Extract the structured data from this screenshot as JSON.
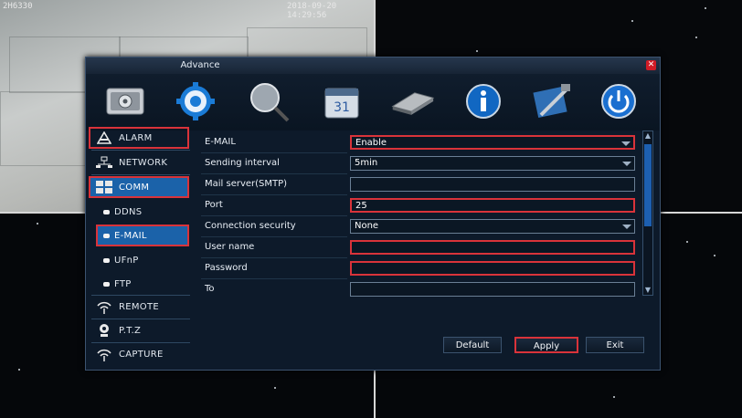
{
  "camera": {
    "channel_label": "2H6330",
    "timestamp": "2018-09-20 14:29:56"
  },
  "dialog": {
    "title": "Advance",
    "close_icon": "✕",
    "toolbar": [
      {
        "icon": "settings-panel-icon"
      },
      {
        "icon": "gear-icon"
      },
      {
        "icon": "magnifier-icon"
      },
      {
        "icon": "calendar-icon"
      },
      {
        "icon": "hard-disk-icon"
      },
      {
        "icon": "info-icon"
      },
      {
        "icon": "tools-icon"
      },
      {
        "icon": "power-icon"
      }
    ]
  },
  "sidebar": {
    "items": [
      {
        "label": "ALARM",
        "icon": "warning-icon"
      },
      {
        "label": "NETWORK",
        "icon": "network-icon"
      },
      {
        "label": "COMM",
        "icon": "grid-icon"
      },
      {
        "label": "DDNS",
        "icon": "bullet"
      },
      {
        "label": "E-MAIL",
        "icon": "bullet"
      },
      {
        "label": "UFnP",
        "icon": "bullet"
      },
      {
        "label": "FTP",
        "icon": "bullet"
      },
      {
        "label": "REMOTE",
        "icon": "wifi-icon"
      },
      {
        "label": "P.T.Z",
        "icon": "camera-icon"
      },
      {
        "label": "CAPTURE",
        "icon": "wifi-icon"
      }
    ]
  },
  "form": {
    "rows": [
      {
        "label": "E-MAIL",
        "value": "Enable",
        "type": "select"
      },
      {
        "label": "Sending interval",
        "value": "5min",
        "type": "select"
      },
      {
        "label": "Mail server(SMTP)",
        "value": "",
        "type": "text"
      },
      {
        "label": "Port",
        "value": "25",
        "type": "text"
      },
      {
        "label": "Connection security",
        "value": "None",
        "type": "select"
      },
      {
        "label": "User name",
        "value": "",
        "type": "text"
      },
      {
        "label": "Password",
        "value": "",
        "type": "text"
      },
      {
        "label": "To",
        "value": "",
        "type": "text"
      }
    ]
  },
  "buttons": {
    "default_label": "Default",
    "apply_label": "Apply",
    "exit_label": "Exit"
  },
  "colors": {
    "highlight": "#d9333a",
    "selected": "#1b62a9",
    "panel": "#0d1a2a"
  }
}
